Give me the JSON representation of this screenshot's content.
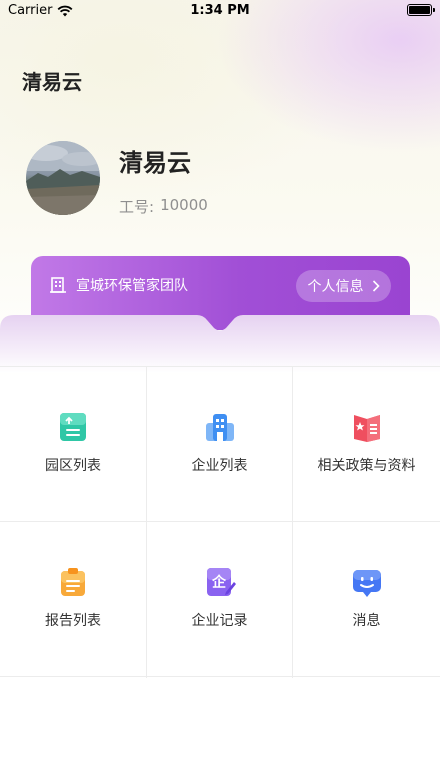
{
  "status_bar": {
    "carrier": "Carrier",
    "time": "1:34 PM"
  },
  "header": {
    "title": "清易云"
  },
  "profile": {
    "name": "清易云",
    "id_label": "工号:",
    "id_value": "10000"
  },
  "team": {
    "name": "宣城环保管家团队",
    "info_button": "个人信息"
  },
  "menu": [
    {
      "label": "园区列表",
      "icon": "park-list-icon"
    },
    {
      "label": "企业列表",
      "icon": "company-building-icon"
    },
    {
      "label": "相关政策与资料",
      "icon": "policy-book-icon"
    },
    {
      "label": "报告列表",
      "icon": "report-clipboard-icon"
    },
    {
      "label": "企业记录",
      "icon": "company-record-icon"
    },
    {
      "label": "消息",
      "icon": "message-icon"
    }
  ],
  "colors": {
    "accent": "#a14fd6",
    "teal": "#2fc7a6",
    "blue": "#3f8ff2",
    "red": "#ef4f5f",
    "orange": "#f8a93a",
    "purple": "#8a63f0",
    "msg_blue": "#4577f4"
  }
}
